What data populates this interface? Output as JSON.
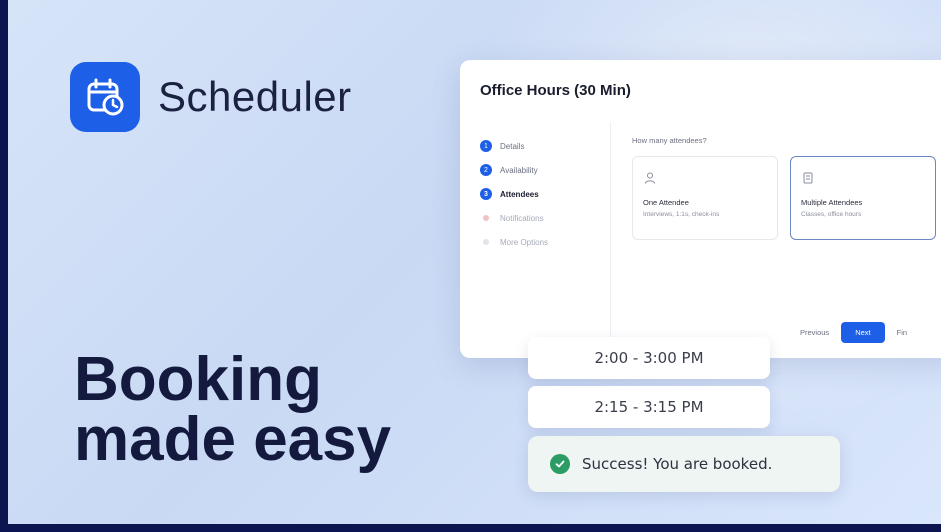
{
  "brand": {
    "name": "Scheduler",
    "icon": "calendar-clock-icon",
    "accent": "#1d5fe6"
  },
  "headline": {
    "line1": "Booking",
    "line2": "made easy"
  },
  "panel": {
    "title": "Office Hours (30 Min)",
    "steps": [
      {
        "num": "1",
        "label": "Details"
      },
      {
        "num": "2",
        "label": "Availability"
      },
      {
        "num": "3",
        "label": "Attendees"
      },
      {
        "num": "",
        "label": "Notifications"
      },
      {
        "num": "",
        "label": "More Options"
      }
    ],
    "question": "How many attendees?",
    "options": [
      {
        "icon": "person-icon",
        "title": "One Attendee",
        "desc": "Interviews, 1:1s, check-ins"
      },
      {
        "icon": "group-icon",
        "title": "Multiple Attendees",
        "desc": "Classes, office hours"
      }
    ],
    "previous_label": "Previous",
    "next_label": "Next",
    "finish_label": "Fin"
  },
  "slots": [
    "2:00 - 3:00 PM",
    "2:15 - 3:15 PM"
  ],
  "toast": {
    "message": "Success! You are booked.",
    "icon": "check-circle-icon",
    "color": "#2a9c64"
  }
}
